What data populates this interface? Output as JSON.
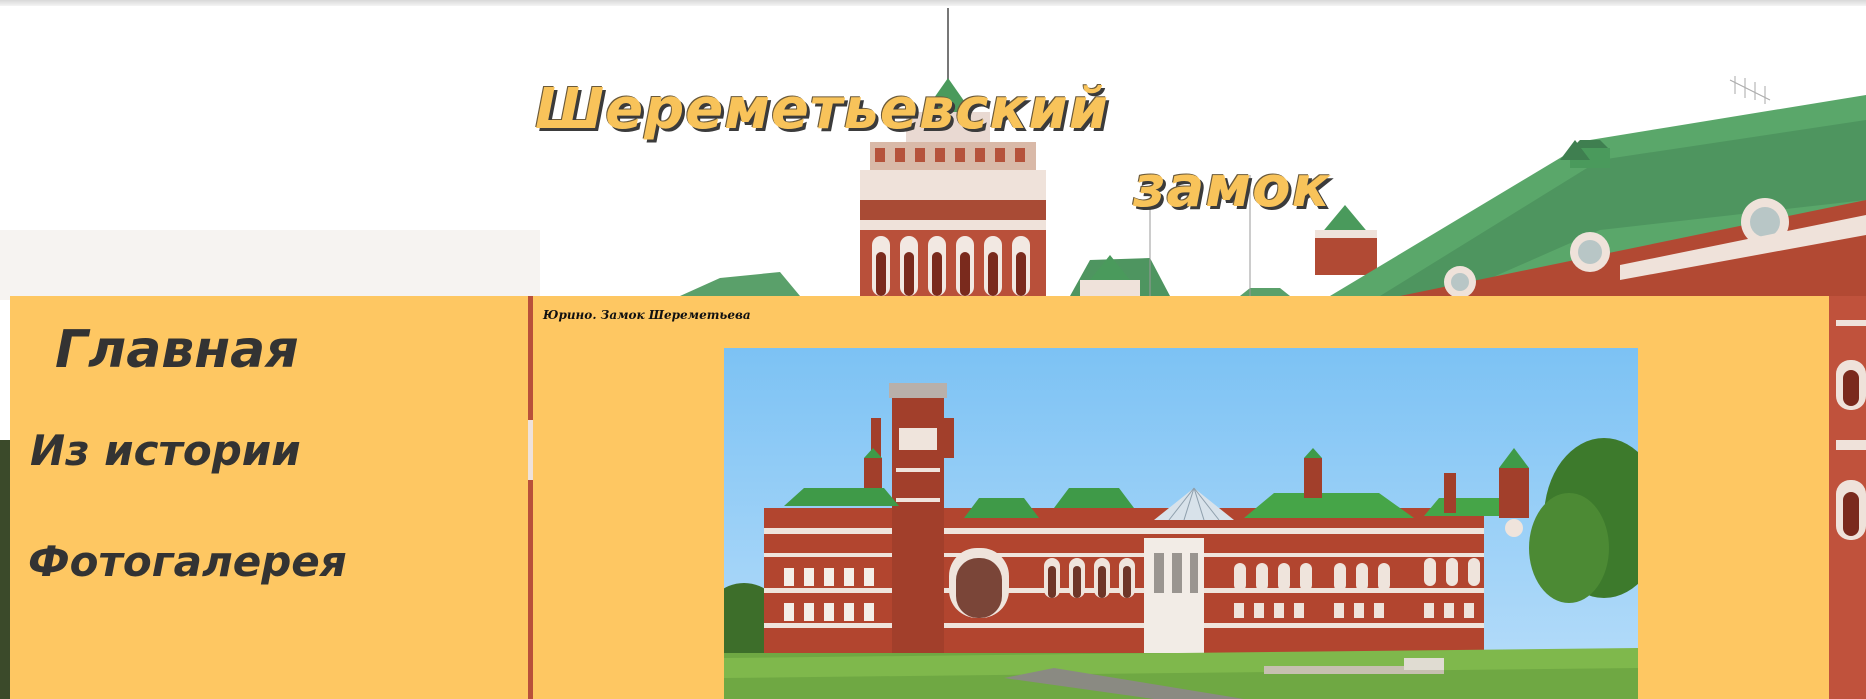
{
  "header": {
    "title_line1": "Шереметьевский",
    "title_line2": "замок"
  },
  "nav": {
    "items": [
      {
        "label": "Главная"
      },
      {
        "label": "Из истории"
      },
      {
        "label": "Фотогалерея"
      }
    ]
  },
  "content": {
    "caption": "Юрино. Замок Шереметьева"
  },
  "colors": {
    "panel": "#fec762",
    "title_fill": "#f8c35a",
    "nav_text": "#333333",
    "roof_green": "#4a9a5c",
    "brick": "#a8442e",
    "sky": "#87c8f5"
  }
}
